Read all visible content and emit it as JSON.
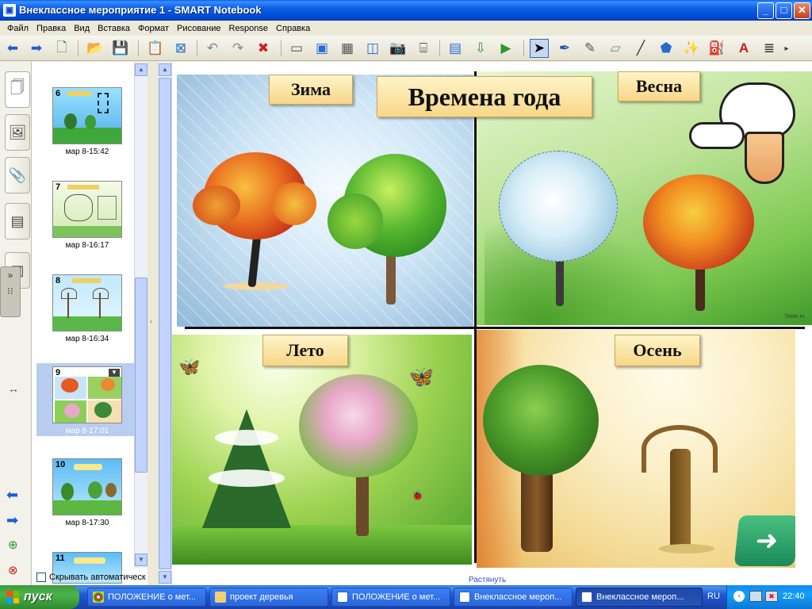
{
  "window": {
    "title": "Внеклассное мероприятие 1 - SMART Notebook",
    "minimize": "_",
    "maximize": "□",
    "close": "✕"
  },
  "menu": [
    "Файл",
    "Правка",
    "Вид",
    "Вставка",
    "Формат",
    "Рисование",
    "Response",
    "Справка"
  ],
  "slides": [
    {
      "num": "6",
      "date": "мар 8-15:42"
    },
    {
      "num": "7",
      "date": "мар 8-16:17"
    },
    {
      "num": "8",
      "date": "мар 8-16:34"
    },
    {
      "num": "9",
      "date": "мар 8-17:01",
      "selected": true
    },
    {
      "num": "10",
      "date": "мар 8-17:30"
    },
    {
      "num": "11",
      "date": ""
    }
  ],
  "autohide_label": "Скрывать автоматическ",
  "page": {
    "title": "Времена года",
    "labels": {
      "winter": "Зима",
      "spring": "Весна",
      "summer": "Лето",
      "autumn": "Осень"
    },
    "watermark": "7oom.ru",
    "resize_hint": "Растянуть"
  },
  "taskbar": {
    "start": "пуск",
    "tasks": [
      "ПОЛОЖЕНИЕ о мет...",
      "проект деревья",
      "ПОЛОЖЕНИЕ о мет...",
      "Внеклассное мероп...",
      "Внеклассное мероп..."
    ],
    "lang": "RU",
    "clock": "22:40"
  }
}
